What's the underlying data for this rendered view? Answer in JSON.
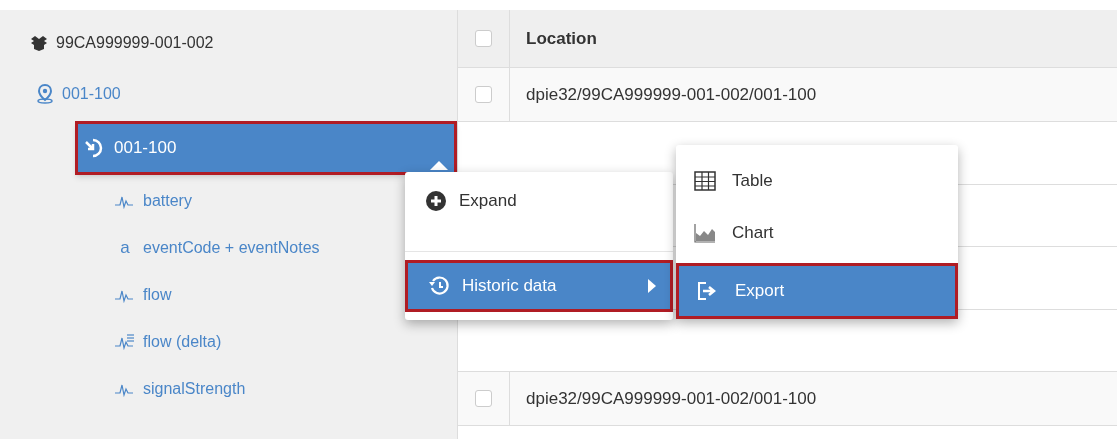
{
  "tree": [
    {
      "label": "99CA999999-001-002",
      "kind": "device",
      "selected": false,
      "children": [
        {
          "label": "001-100",
          "kind": "location",
          "selected": false,
          "children": [
            {
              "label": "001-100",
              "kind": "asset",
              "selected": true,
              "children": [
                {
                  "label": "battery",
                  "kind": "sensor",
                  "selected": false
                },
                {
                  "label": "eventCode + eventNotes",
                  "kind": "text",
                  "glyph": "a",
                  "selected": false
                },
                {
                  "label": "flow",
                  "kind": "sensor",
                  "selected": false
                },
                {
                  "label": "flow (delta)",
                  "kind": "delta",
                  "selected": false
                },
                {
                  "label": "signalStrength",
                  "kind": "sensor",
                  "selected": false
                }
              ]
            }
          ]
        }
      ]
    }
  ],
  "table": {
    "header": {
      "checked": false,
      "label": "Location"
    },
    "rows": [
      {
        "checked": false,
        "location": "dpie32/99CA999999-001-002/001-100"
      },
      {
        "checked": false,
        "location": "dpie32/99CA999999-001-002/001-100"
      }
    ]
  },
  "context_menu": {
    "items": [
      {
        "label": "Expand",
        "selected": false,
        "submenu": false
      },
      {
        "label": "Historic data",
        "selected": true,
        "submenu": true
      }
    ]
  },
  "submenu": {
    "items": [
      {
        "label": "Table",
        "selected": false
      },
      {
        "label": "Chart",
        "selected": false
      },
      {
        "label": "Export",
        "selected": true
      }
    ]
  }
}
